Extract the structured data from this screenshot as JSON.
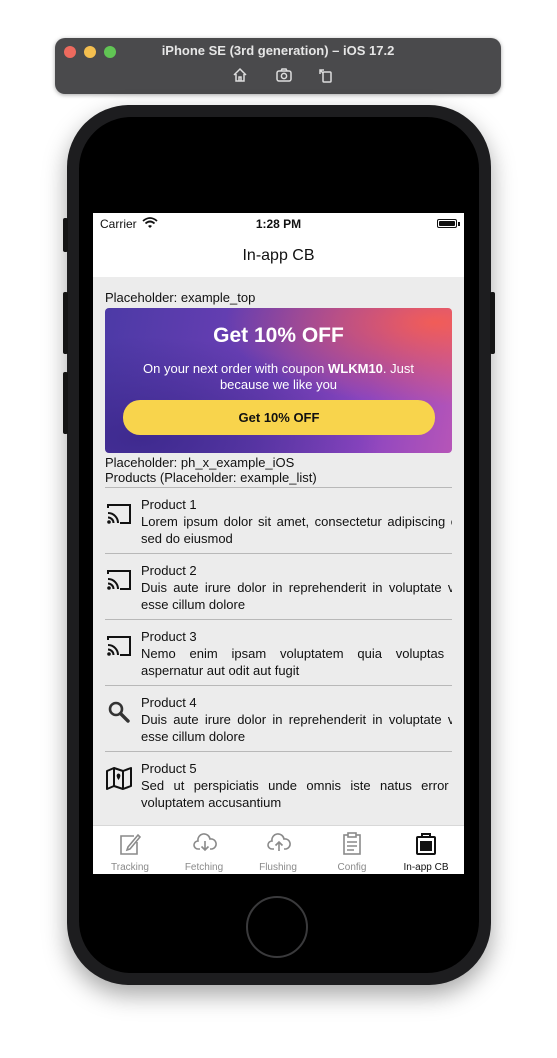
{
  "window": {
    "title": "iPhone SE (3rd generation) – iOS 17.2"
  },
  "status_bar": {
    "carrier": "Carrier",
    "time": "1:28 PM"
  },
  "nav": {
    "title": "In-app CB"
  },
  "placeholders": {
    "top_label": "Placeholder: example_top",
    "ios_label": "Placeholder: ph_x_example_iOS",
    "list_label": "Products (Placeholder: example_list)"
  },
  "banner": {
    "title": "Get 10% OFF",
    "text_before": "On your next order with coupon ",
    "coupon": "WLKM10",
    "text_after": ". Just because we like you",
    "button_label": "Get 10% OFF",
    "button_color": "#f8d44c"
  },
  "products": [
    {
      "title": "Product 1",
      "description": "Lorem ipsum dolor sit amet, consectetur adipiscing elit, sed do eiusmod",
      "icon": "cast-icon"
    },
    {
      "title": "Product 2",
      "description": "Duis aute irure dolor in reprehenderit in voluptate velit esse cillum dolore",
      "icon": "cast-icon"
    },
    {
      "title": "Product 3",
      "description": "Nemo enim ipsam voluptatem quia voluptas sit aspernatur aut odit aut fugit",
      "icon": "cast-icon"
    },
    {
      "title": "Product 4",
      "description": "Duis aute irure dolor in reprehenderit in voluptate velit esse cillum dolore",
      "icon": "search-icon"
    },
    {
      "title": "Product 5",
      "description": "Sed ut perspiciatis unde omnis iste natus error sit voluptatem accusantium",
      "icon": "map-icon"
    }
  ],
  "tabs": [
    {
      "label": "Tracking",
      "icon": "edit-icon"
    },
    {
      "label": "Fetching",
      "icon": "cloud-download-icon"
    },
    {
      "label": "Flushing",
      "icon": "cloud-upload-icon"
    },
    {
      "label": "Config",
      "icon": "clipboard-icon"
    },
    {
      "label": "In-app CB",
      "icon": "briefcase-icon",
      "active": true
    }
  ]
}
